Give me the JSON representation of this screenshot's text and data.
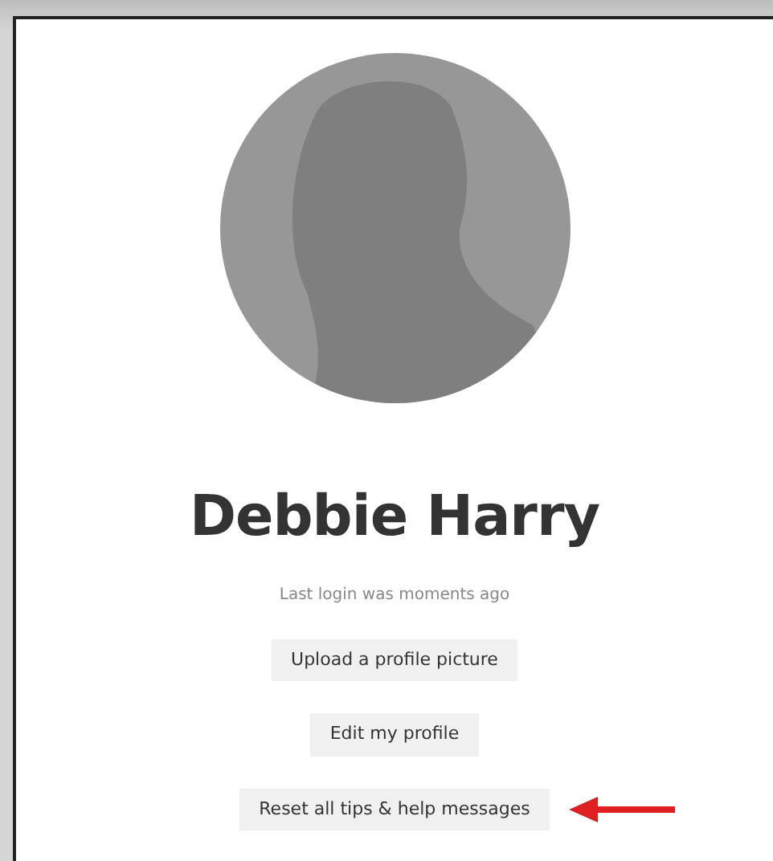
{
  "profile": {
    "name": "Debbie Harry",
    "last_login": "Last login was moments ago"
  },
  "buttons": [
    {
      "label": "Upload a profile picture",
      "pointed_at": false
    },
    {
      "label": "Edit my profile",
      "pointed_at": false
    },
    {
      "label": "Reset all tips & help messages",
      "pointed_at": true
    }
  ]
}
